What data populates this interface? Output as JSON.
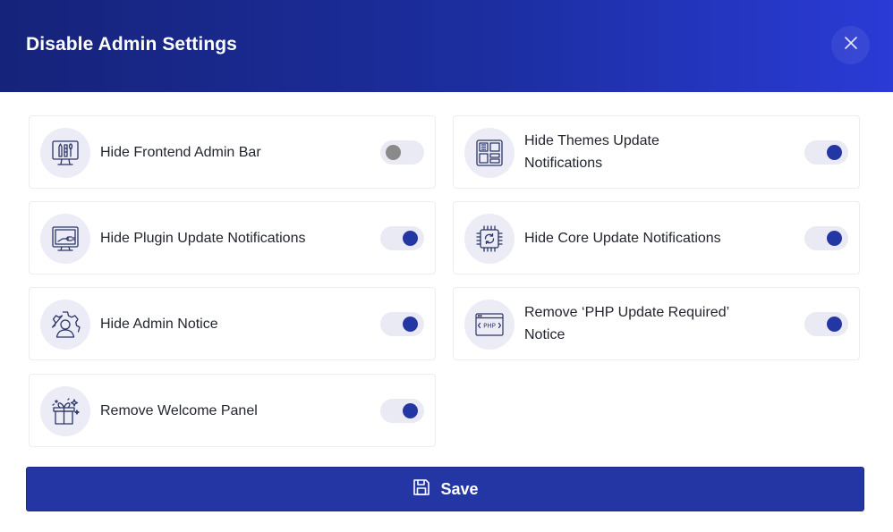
{
  "dialog": {
    "title": "Disable Admin Settings",
    "close_icon": "close-icon"
  },
  "settings": [
    {
      "label": "Hide Frontend Admin Bar",
      "icon": "monitor-tools-icon",
      "enabled": false
    },
    {
      "label": "Hide Themes Update Notifications",
      "icon": "layout-grid-icon",
      "enabled": true
    },
    {
      "label": "Hide Plugin Update Notifications",
      "icon": "plugin-plug-icon",
      "enabled": true
    },
    {
      "label": "Hide Core Update Notifications",
      "icon": "cpu-refresh-icon",
      "enabled": true
    },
    {
      "label": "Hide Admin Notice",
      "icon": "user-gear-icon",
      "enabled": true
    },
    {
      "label": "Remove ‘PHP Update Required’ Notice",
      "icon": "php-window-icon",
      "enabled": true
    },
    {
      "label": "Remove Welcome Panel",
      "icon": "gift-stars-icon",
      "enabled": true
    }
  ],
  "save_button": {
    "label": "Save",
    "icon": "floppy-disk-icon"
  },
  "colors": {
    "header_start": "#16237a",
    "header_end": "#2a3bd6",
    "accent": "#2436a4",
    "toggle_track": "#e9eaf3",
    "toggle_off_knob": "#8a8a8a",
    "icon_bg": "#ececf7"
  }
}
